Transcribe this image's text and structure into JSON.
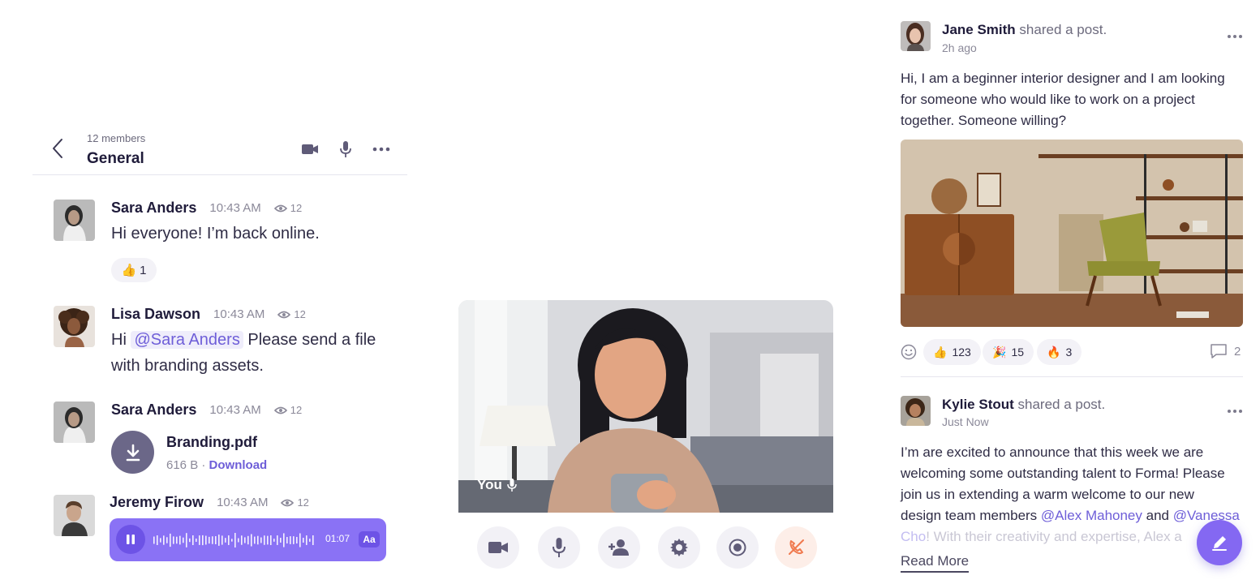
{
  "chat": {
    "members": "12 members",
    "channel": "General",
    "messages": [
      {
        "name": "Sara Anders",
        "time": "10:43 AM",
        "views": "12",
        "text": "Hi everyone! I’m back online.",
        "reaction": {
          "emoji": "👍",
          "count": "1"
        }
      },
      {
        "name": "Lisa Dawson",
        "time": "10:43 AM",
        "views": "12",
        "text_before": "Hi ",
        "mention": "@Sara Anders",
        "text_after": " Please send a file",
        "text_line2": "with branding assets."
      },
      {
        "name": "Sara Anders",
        "time": "10:43 AM",
        "views": "12",
        "file_name": "Branding.pdf",
        "file_size": "616 B",
        "file_sep": " · ",
        "file_link": "Download"
      },
      {
        "name": "Jeremy Firow",
        "time": "10:43 AM",
        "views": "12",
        "voice_duration": "01:07",
        "voice_speed": "Aa"
      }
    ]
  },
  "call": {
    "you_label": "You",
    "controls": [
      "video-icon",
      "microphone-icon",
      "add-user-icon",
      "gear-icon",
      "record-icon",
      "end-call-icon"
    ],
    "end_color": "#f07a4f"
  },
  "feed": {
    "posts": [
      {
        "author": "Jane Smith",
        "action": " shared a post.",
        "time": "2h ago",
        "lines": [
          "Hi, I am a beginner interior designer and I am looking",
          "for someone who would like to work on a project",
          "together. Someone willing?"
        ],
        "reactions": [
          {
            "emoji": "👍",
            "count": "123"
          },
          {
            "emoji": "🎉",
            "count": "15"
          },
          {
            "emoji": "🔥",
            "count": "3"
          }
        ],
        "comments": "2"
      },
      {
        "author": "Kylie Stout",
        "action": " shared a post.",
        "time": "Just Now",
        "lines": [
          "I’m are excited to announce that this week we are",
          "welcoming some outstanding talent to Forma! Please",
          "join us in extending a warm welcome to our new"
        ],
        "line4_prefix": "design team members ",
        "mention1": "@Alex Mahoney",
        "line4_mid": " and ",
        "mention2": "@Vanessa",
        "line5_mention": "Cho",
        "line5_rest": "! With their creativity and expertise, Alex a",
        "read_more": "Read More"
      }
    ]
  },
  "colors": {
    "accent": "#6e5ed8",
    "voice_bg": "#8a72f5",
    "fab_bg": "#8468f2"
  }
}
